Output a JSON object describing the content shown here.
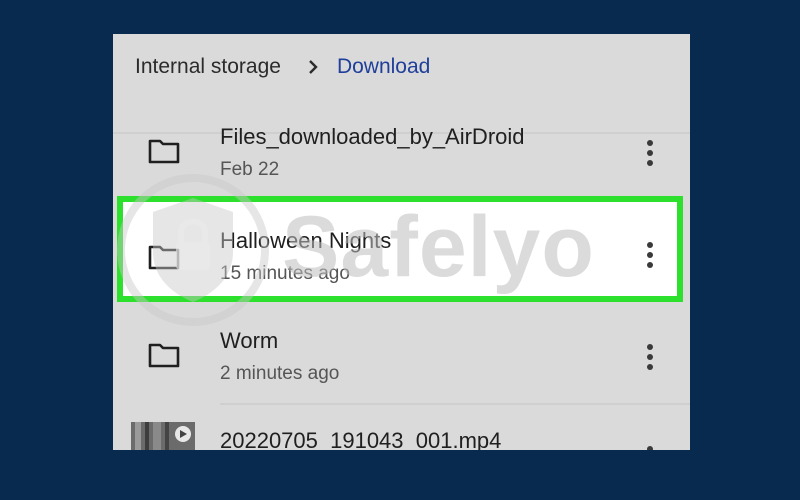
{
  "breadcrumb": {
    "root": "Internal storage",
    "separator_icon": "chevron-right-icon",
    "current": "Download"
  },
  "files": [
    {
      "name": "Files_downloaded_by_AirDroid",
      "meta": "Feb 22",
      "icon": "folder-icon"
    },
    {
      "name": "Halloween Nights",
      "meta": "15 minutes ago",
      "icon": "folder-icon",
      "highlighted": true
    },
    {
      "name": "Worm",
      "meta": "2 minutes ago",
      "icon": "folder-icon"
    },
    {
      "name": "20220705_191043_001.mp4",
      "meta": "",
      "icon": "video-thumbnail"
    }
  ],
  "watermark": {
    "text": "Safelyo"
  },
  "colors": {
    "background": "#082a4f",
    "panel": "#dadada",
    "highlight_border": "#2de02d",
    "breadcrumb_active": "#1f3f9a"
  }
}
